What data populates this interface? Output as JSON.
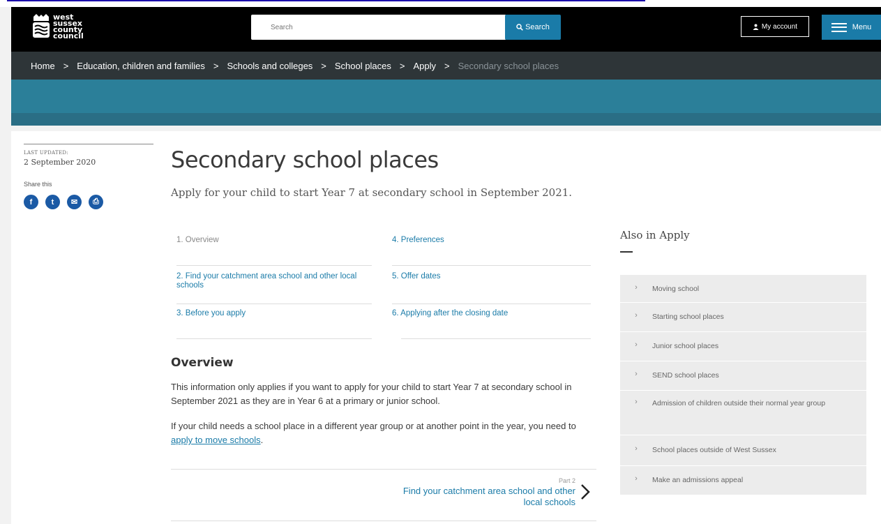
{
  "header": {
    "logo_words": [
      "west",
      "sussex",
      "county",
      "council"
    ],
    "search_placeholder": "Search",
    "search_button_label": "Search",
    "account_label": "My account",
    "menu_label": "Menu"
  },
  "breadcrumb": [
    {
      "label": "Home"
    },
    {
      "label": "Education, children and families"
    },
    {
      "label": "Schools and colleges"
    },
    {
      "label": "School places"
    },
    {
      "label": "Apply"
    },
    {
      "label": "Secondary school places"
    }
  ],
  "breadcrumb_separator": ">",
  "meta": {
    "last_updated_label": "LAST UPDATED:",
    "last_updated_date": "2 September 2020",
    "share_label": "Share this",
    "share_icons": [
      "facebook-icon",
      "twitter-icon",
      "email-icon",
      "print-icon"
    ],
    "share_glyphs": [
      "f",
      "t",
      "✉",
      "⎙"
    ]
  },
  "page": {
    "title": "Secondary school places",
    "lead": "Apply for your child to start Year 7 at secondary school in September 2021."
  },
  "contents": [
    {
      "label": "1. Overview",
      "current": true
    },
    {
      "label": "2. Find your catchment area school and other local schools",
      "current": false
    },
    {
      "label": "3. Before you apply",
      "current": false
    },
    {
      "label": "4. Preferences",
      "current": false
    },
    {
      "label": "5. Offer dates",
      "current": false
    },
    {
      "label": "6. Applying after the closing date",
      "current": false
    }
  ],
  "overview": {
    "heading": "Overview",
    "para1": "This information only applies if you want to apply for your child to start Year 7 at secondary school in September 2021 as they are in Year 6 at a primary or junior school.",
    "para2_before": "If your child needs a school place in a different year group or at another point in the year, you need to ",
    "para2_link": "apply to move schools",
    "para2_after": "."
  },
  "next": {
    "part_label": "Part 2",
    "title": "Find your catchment area school and other local schools"
  },
  "aside": {
    "title": "Also in Apply",
    "items": [
      "Moving school",
      "Starting school places",
      "Junior school places",
      "SEND school places",
      "Admission of children outside their normal year group",
      "School places outside of West Sussex",
      "Make an admissions appeal"
    ]
  },
  "colors": {
    "brand_blue": "#1a7ba8",
    "header_black": "#000000",
    "breadcrumb_bg": "#2e3538",
    "hero_teal": "#2b7f99",
    "share_blue": "#1b5aa5"
  }
}
